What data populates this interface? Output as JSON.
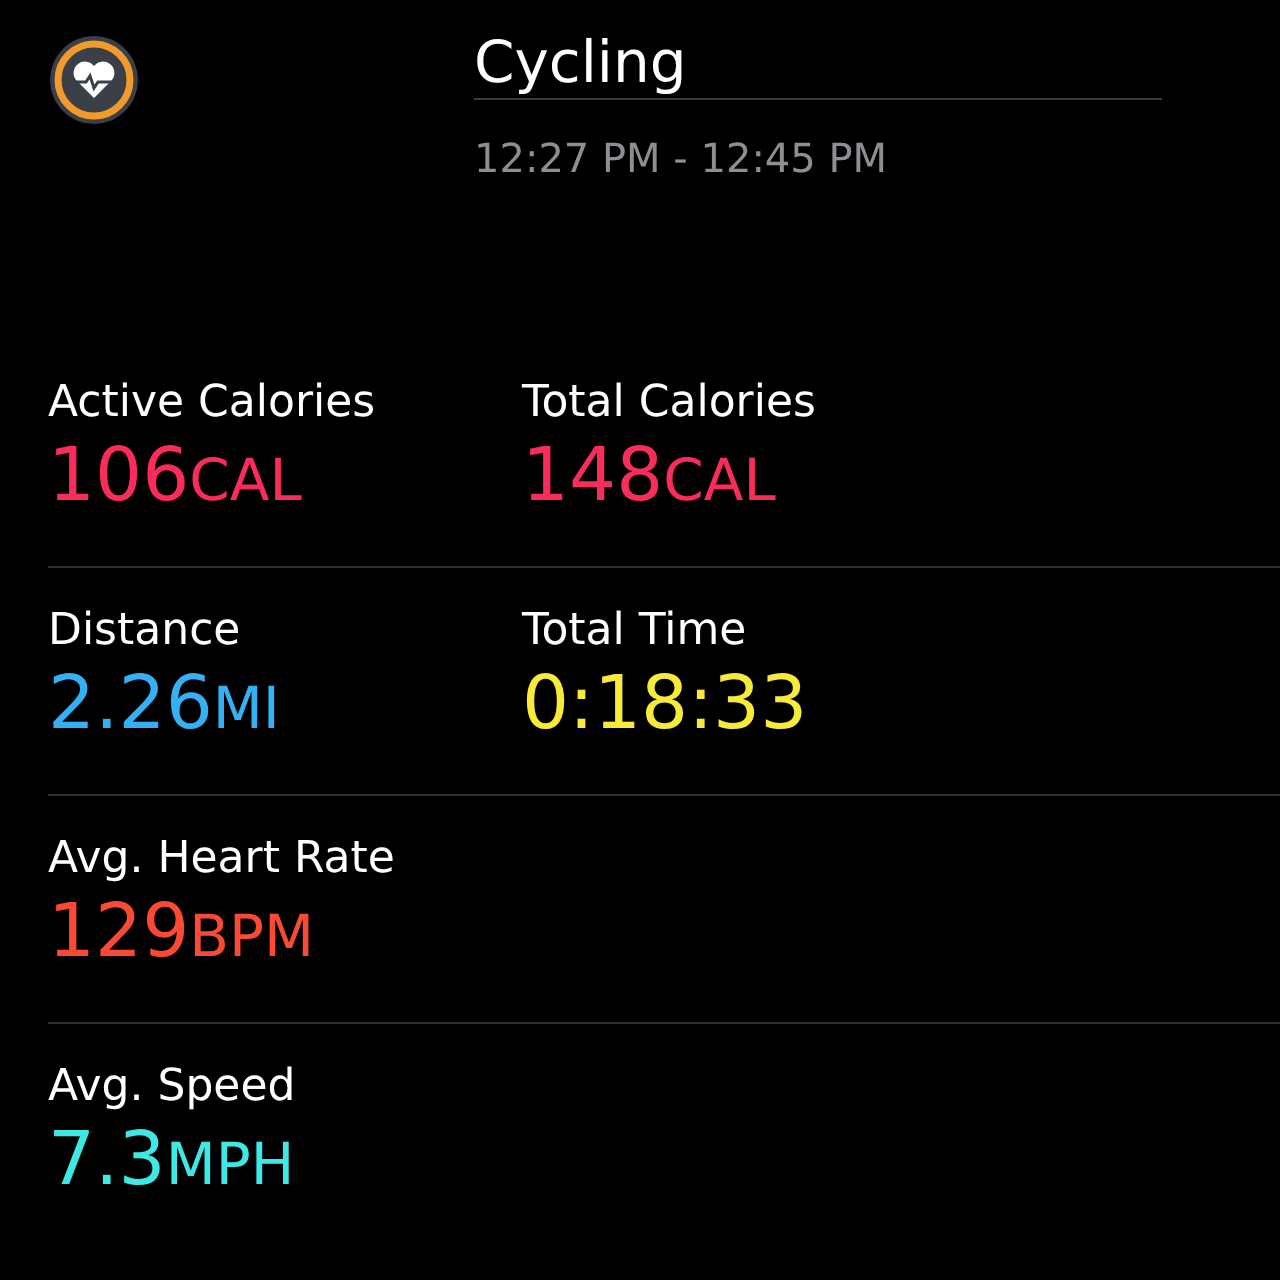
{
  "workout": {
    "title": "Cycling",
    "time_range": "12:27 PM - 12:45 PM"
  },
  "rows": [
    {
      "metrics": [
        {
          "label": "Active Calories",
          "value": "106",
          "unit": "CAL",
          "color": "#fa2c5a"
        },
        {
          "label": "Total Calories",
          "value": "148",
          "unit": "CAL",
          "color": "#fa2c5a"
        }
      ]
    },
    {
      "metrics": [
        {
          "label": "Distance",
          "value": "2.26",
          "unit": "MI",
          "color": "#35b0f5"
        },
        {
          "label": "Total Time",
          "value": "0:18:33",
          "color": "#f7ea38"
        }
      ]
    },
    {
      "metrics": [
        {
          "label": "Avg. Heart Rate",
          "value": "129",
          "unit": "BPM",
          "color": "#fb4a34"
        }
      ]
    },
    {
      "metrics": [
        {
          "label": "Avg. Speed",
          "value": "7.3",
          "unit": "MPH",
          "color": "#3ee8e4"
        }
      ]
    }
  ]
}
